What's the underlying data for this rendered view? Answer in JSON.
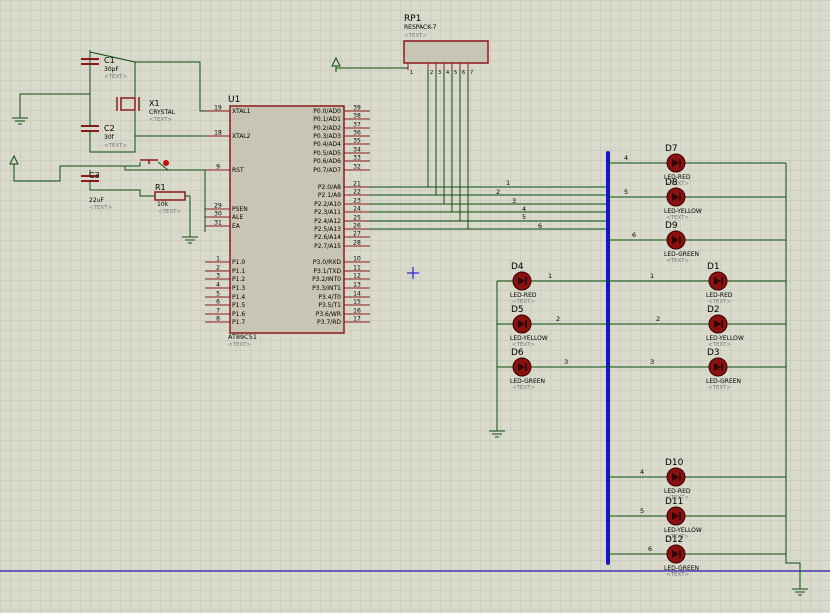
{
  "colors": {
    "background": "#d9d9cc",
    "grid": "#c3c3b4",
    "wire": "#0b4f0b",
    "component": "#8b1a1a",
    "chip_fill": "#c8c5b4",
    "bus": "#1616c8",
    "led_fill": "#8b1010",
    "text": "#000000",
    "placeholder": "#7a7a7a"
  },
  "placeholder_text": "<TEXT>",
  "parts": {
    "c1": {
      "ref": "C1",
      "value": "30pF"
    },
    "c2": {
      "ref": "C2",
      "value": "30f"
    },
    "c3": {
      "ref": "C3",
      "value": "22uF"
    },
    "x1": {
      "ref": "X1",
      "value": "CRYSTAL"
    },
    "r1": {
      "ref": "R1",
      "value": "10k"
    },
    "u1": {
      "ref": "U1",
      "value": "AT89C51"
    },
    "rp1": {
      "ref": "RP1",
      "value": "RESPACK-7"
    }
  },
  "mcu": {
    "left_pins": [
      {
        "num": "19",
        "name": "XTAL1"
      },
      {
        "num": "18",
        "name": "XTAL2"
      },
      {
        "num": "9",
        "name": "RST"
      },
      {
        "num": "29",
        "name": "PSEN"
      },
      {
        "num": "30",
        "name": "ALE"
      },
      {
        "num": "31",
        "name": "EA"
      },
      {
        "num": "1",
        "name": "P1.0"
      },
      {
        "num": "2",
        "name": "P1.1"
      },
      {
        "num": "3",
        "name": "P1.2"
      },
      {
        "num": "4",
        "name": "P1.3"
      },
      {
        "num": "5",
        "name": "P1.4"
      },
      {
        "num": "6",
        "name": "P1.5"
      },
      {
        "num": "7",
        "name": "P1.6"
      },
      {
        "num": "8",
        "name": "P1.7"
      }
    ],
    "right_pins": [
      {
        "num": "39",
        "name": "P0.0/AD0"
      },
      {
        "num": "38",
        "name": "P0.1/AD1"
      },
      {
        "num": "37",
        "name": "P0.2/AD2"
      },
      {
        "num": "36",
        "name": "P0.3/AD3"
      },
      {
        "num": "35",
        "name": "P0.4/AD4"
      },
      {
        "num": "34",
        "name": "P0.5/AD5"
      },
      {
        "num": "33",
        "name": "P0.6/AD6"
      },
      {
        "num": "32",
        "name": "P0.7/AD7"
      },
      {
        "num": "21",
        "name": "P2.0/A8"
      },
      {
        "num": "22",
        "name": "P2.1/A9"
      },
      {
        "num": "23",
        "name": "P2.2/A10"
      },
      {
        "num": "24",
        "name": "P2.3/A11"
      },
      {
        "num": "25",
        "name": "P2.4/A12"
      },
      {
        "num": "26",
        "name": "P2.5/A13"
      },
      {
        "num": "27",
        "name": "P2.6/A14"
      },
      {
        "num": "28",
        "name": "P2.7/A15"
      },
      {
        "num": "10",
        "name": "P3.0/RXD"
      },
      {
        "num": "11",
        "name": "P3.1/TXD"
      },
      {
        "num": "12",
        "name": "P3.2/INT0"
      },
      {
        "num": "13",
        "name": "P3.3/INT1"
      },
      {
        "num": "14",
        "name": "P3.4/T0"
      },
      {
        "num": "15",
        "name": "P3.5/T1"
      },
      {
        "num": "16",
        "name": "P3.6/WR"
      },
      {
        "num": "17",
        "name": "P3.7/RD"
      }
    ]
  },
  "respack_pins": [
    "1",
    "2",
    "3",
    "4",
    "5",
    "6",
    "7"
  ],
  "bus_net_labels": [
    "1",
    "2",
    "3",
    "4",
    "5",
    "6"
  ],
  "leds": [
    {
      "ref": "D7",
      "type": "LED-RED",
      "net": "4"
    },
    {
      "ref": "D8",
      "type": "LED-YELLOW",
      "net": "5"
    },
    {
      "ref": "D9",
      "type": "LED-GREEN",
      "net": "6"
    },
    {
      "ref": "D4",
      "type": "LED-RED",
      "net": "1"
    },
    {
      "ref": "D5",
      "type": "LED-YELLOW",
      "net": "2"
    },
    {
      "ref": "D6",
      "type": "LED-GREEN",
      "net": "3"
    },
    {
      "ref": "D1",
      "type": "LED-RED",
      "net": "1"
    },
    {
      "ref": "D2",
      "type": "LED-YELLOW",
      "net": "2"
    },
    {
      "ref": "D3",
      "type": "LED-GREEN",
      "net": "3"
    },
    {
      "ref": "D10",
      "type": "LED-RED",
      "net": "4"
    },
    {
      "ref": "D11",
      "type": "LED-YELLOW",
      "net": "5"
    },
    {
      "ref": "D12",
      "type": "LED-GREEN",
      "net": "6"
    }
  ]
}
